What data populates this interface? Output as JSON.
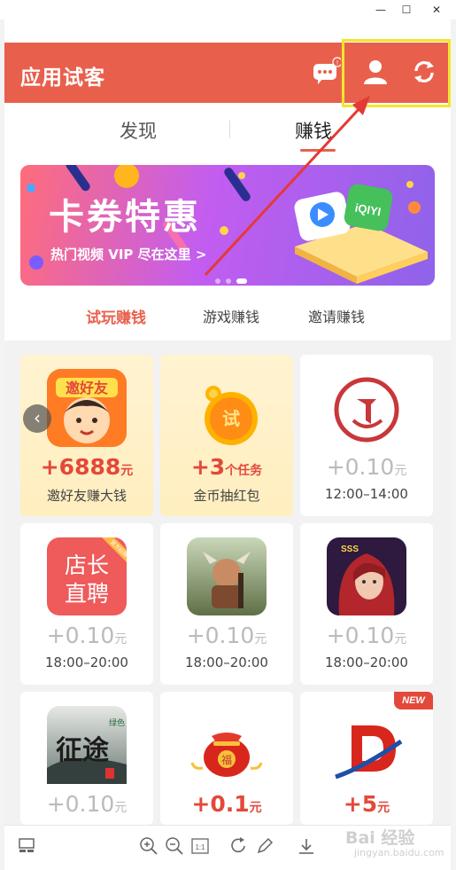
{
  "window": {
    "minimize_label": "—",
    "maximize_label": "☐",
    "close_label": "✕"
  },
  "header": {
    "title": "应用试客",
    "icons": [
      "message-icon",
      "user-icon",
      "refresh-icon"
    ],
    "badge": "!"
  },
  "tabs": [
    {
      "label": "发现",
      "active": false
    },
    {
      "label": "赚钱",
      "active": true
    }
  ],
  "banner": {
    "title": "卡券特惠",
    "subtitle": "热门视频 VIP 尽在这里 >",
    "page_count": 3,
    "active_page": 2
  },
  "subtabs": [
    {
      "label": "试玩赚钱",
      "active": true
    },
    {
      "label": "游戏赚钱",
      "active": false
    },
    {
      "label": "邀请赚钱",
      "active": false
    }
  ],
  "cards": [
    {
      "icon": "invite-friends-icon",
      "amount": "+6888",
      "unit": "元",
      "caption": "邀好友赚大钱",
      "style": "gold"
    },
    {
      "icon": "gold-coin-icon",
      "amount": "+3",
      "unit": "个任务",
      "caption": "金币抽红包",
      "style": "gold"
    },
    {
      "icon": "red-logo-icon",
      "amount": "+0.10",
      "unit": "元",
      "caption": "12:00–14:00",
      "style": "plain"
    },
    {
      "icon": "shop-manager-icon",
      "amount": "+0.10",
      "unit": "元",
      "caption": "18:00–20:00",
      "style": "plain"
    },
    {
      "icon": "game-character-icon",
      "amount": "+0.10",
      "unit": "元",
      "caption": "18:00–20:00",
      "style": "plain"
    },
    {
      "icon": "game-heroine-icon",
      "amount": "+0.10",
      "unit": "元",
      "caption": "18:00–20:00",
      "style": "plain"
    },
    {
      "icon": "ink-game-icon",
      "amount": "+0.10",
      "unit": "元",
      "caption": "",
      "style": "plain"
    },
    {
      "icon": "lucky-bag-icon",
      "amount": "+0.1",
      "unit": "元",
      "caption": "",
      "style": "red"
    },
    {
      "icon": "d-logo-icon",
      "amount": "+5",
      "unit": "元",
      "caption": "",
      "style": "red",
      "badge": "NEW"
    }
  ],
  "card_icon_text": {
    "invite": "邀好友",
    "coin": "试",
    "shop": [
      "店长",
      "直聘"
    ],
    "shop_tag": "官方招聘",
    "ink": "征途",
    "ink_tag": "绿色",
    "hero_tag": "SSS",
    "bag": "福"
  },
  "toolbar": {
    "icons": [
      "layout-icon",
      "zoom-in-icon",
      "zoom-out-icon",
      "actual-size-icon",
      "rotate-icon",
      "edit-icon",
      "download-icon"
    ],
    "actual_size_label": "1:1"
  },
  "watermark": {
    "text": "Bai 经验",
    "sub": "jingyan.baidu.com"
  },
  "colors": {
    "accent": "#e8604c",
    "highlight": "#f3e62b",
    "annotation_arrow": "#e53935"
  }
}
